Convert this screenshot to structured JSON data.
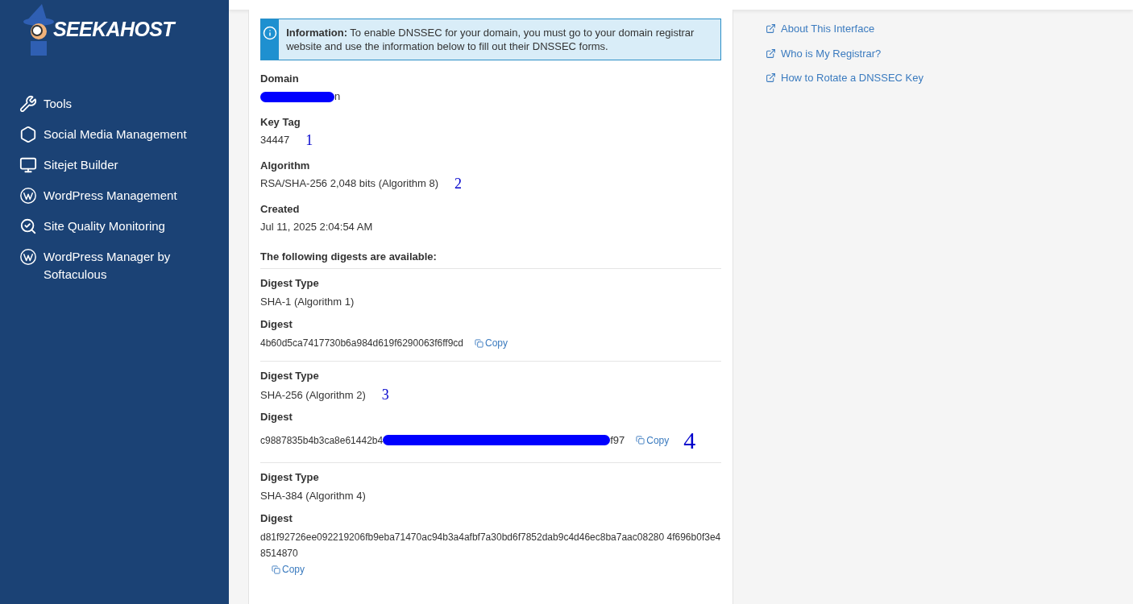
{
  "logo": {
    "text": "SEEKAHOST"
  },
  "sidebar": {
    "items": [
      {
        "label": "Tools",
        "kind": "tools"
      },
      {
        "label": "Social Media Management",
        "kind": "social"
      },
      {
        "label": "Sitejet Builder",
        "kind": "monitor"
      },
      {
        "label": "WordPress Management",
        "kind": "wordpress"
      },
      {
        "label": "Site Quality Monitoring",
        "kind": "search-check"
      },
      {
        "label": "WordPress Manager by Softaculous",
        "kind": "wordpress"
      }
    ]
  },
  "info": {
    "title": "Information:",
    "text": "To enable DNSSEC for your domain, you must go to your domain registrar website and use the information below to fill out their DNSSEC forms."
  },
  "fields": [
    {
      "label": "Domain",
      "value": "n",
      "redacted": true
    },
    {
      "label": "Key Tag",
      "value": "34447",
      "marker": "1"
    },
    {
      "label": "Algorithm",
      "value": "RSA/SHA-256 2,048 bits (Algorithm 8)",
      "marker": "2"
    },
    {
      "label": "Created",
      "value": "Jul 11, 2025 2:04:54 AM"
    }
  ],
  "digests_heading": "The following digests are available:",
  "digests": [
    {
      "type_label": "Digest Type",
      "type": "SHA-1 (Algorithm 1)",
      "digest_label": "Digest",
      "digest": "4b60d5ca7417730b6a984d619f6290063f6ff9cd",
      "copy": "Copy",
      "redacted": false
    },
    {
      "type_label": "Digest Type",
      "type": "SHA-256 (Algorithm 2)",
      "type_marker": "3",
      "digest_label": "Digest",
      "digest": "c9887835b4b3ca8e61442b4",
      "digest_end": "f97",
      "copy": "Copy",
      "copy_marker": "4",
      "redacted": true
    },
    {
      "type_label": "Digest Type",
      "type": "SHA-384 (Algorithm 4)",
      "digest_label": "Digest",
      "digest": "d81f92726ee092219206fb9eba71470ac94b3a4afbf7a30bd6f7852dab9c4d46ec8ba7aac08280 4f696b0f3e48514870",
      "copy": "Copy",
      "redacted": false
    }
  ],
  "links": [
    {
      "label": "About This Interface"
    },
    {
      "label": "Who is My Registrar?"
    },
    {
      "label": "How to Rotate a DNSSEC Key"
    }
  ]
}
